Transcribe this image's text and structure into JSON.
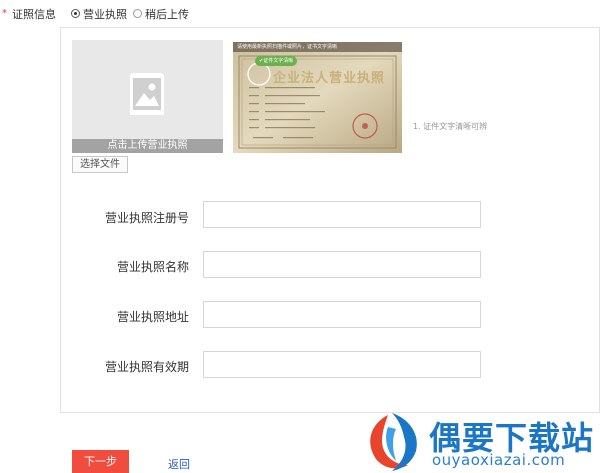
{
  "cert": {
    "required_mark": "*",
    "label": "证照信息",
    "options": [
      {
        "label": "营业执照",
        "selected": true
      },
      {
        "label": "稍后上传",
        "selected": false
      }
    ]
  },
  "upload": {
    "bar_text": "点击上传营业执照",
    "choose_button": "选择文件",
    "sample_overlay": "请使用最新执照扫描件或照片，证书文字清晰",
    "sample_badge": "证件文字清晰",
    "sample_title": "企业法人营业执照",
    "hint": "1. 证件文字清晰可辨"
  },
  "form": {
    "fields": [
      {
        "label": "营业执照注册号",
        "value": ""
      },
      {
        "label": "营业执照名称",
        "value": ""
      },
      {
        "label": "营业执照地址",
        "value": ""
      },
      {
        "label": "营业执照有效期",
        "value": ""
      }
    ]
  },
  "actions": {
    "next": "下一步",
    "back": "返回"
  },
  "watermark": {
    "text": "偶要下载站",
    "url": "ouyaoxiazai.com"
  },
  "colors": {
    "accent_red": "#f04d3f",
    "link_blue": "#2a5bc4",
    "watermark_blue": "#1b76c7"
  }
}
